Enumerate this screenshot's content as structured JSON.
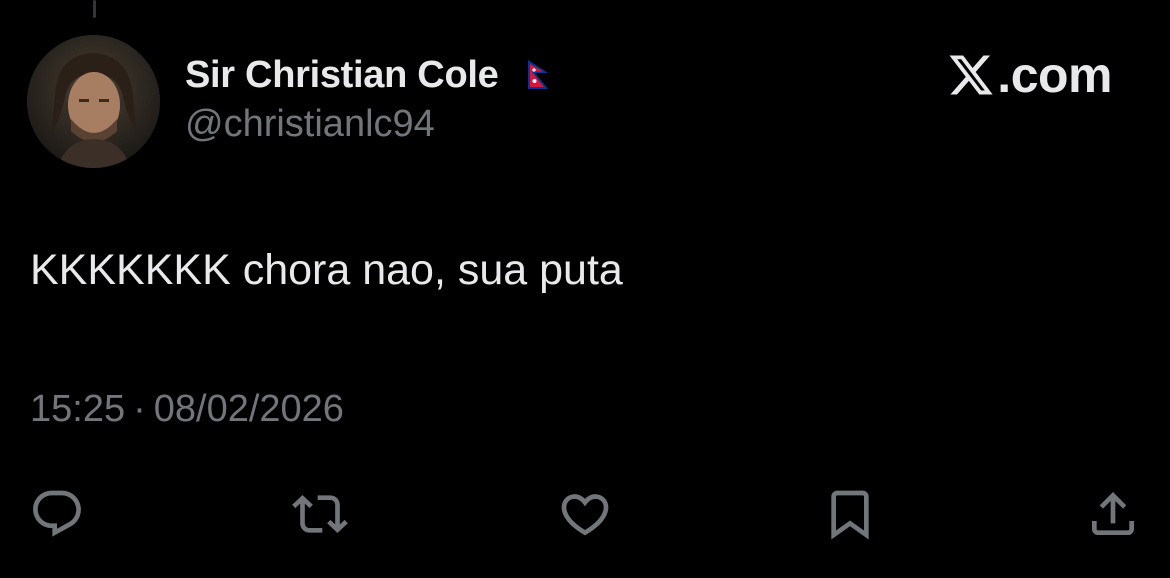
{
  "tweet": {
    "display_name": "Sir Christian Cole",
    "handle": "@christianlc94",
    "text": "KKKKKKK chora nao, sua puta",
    "time": "15:25",
    "separator": "·",
    "date": "08/02/2026"
  },
  "brand": {
    "label": ".com",
    "logo_icon": "x-logo-icon"
  },
  "flag_icon": "nepal-flag-icon",
  "actions": [
    {
      "name": "reply",
      "icon": "reply-icon"
    },
    {
      "name": "repost",
      "icon": "repost-icon"
    },
    {
      "name": "like",
      "icon": "heart-icon"
    },
    {
      "name": "bookmark",
      "icon": "bookmark-icon"
    },
    {
      "name": "share",
      "icon": "share-icon"
    }
  ],
  "colors": {
    "background": "#000000",
    "primary_text": "#e7e9ea",
    "secondary_text": "#71767b",
    "flag_red": "#dc143c",
    "flag_blue": "#003893"
  }
}
